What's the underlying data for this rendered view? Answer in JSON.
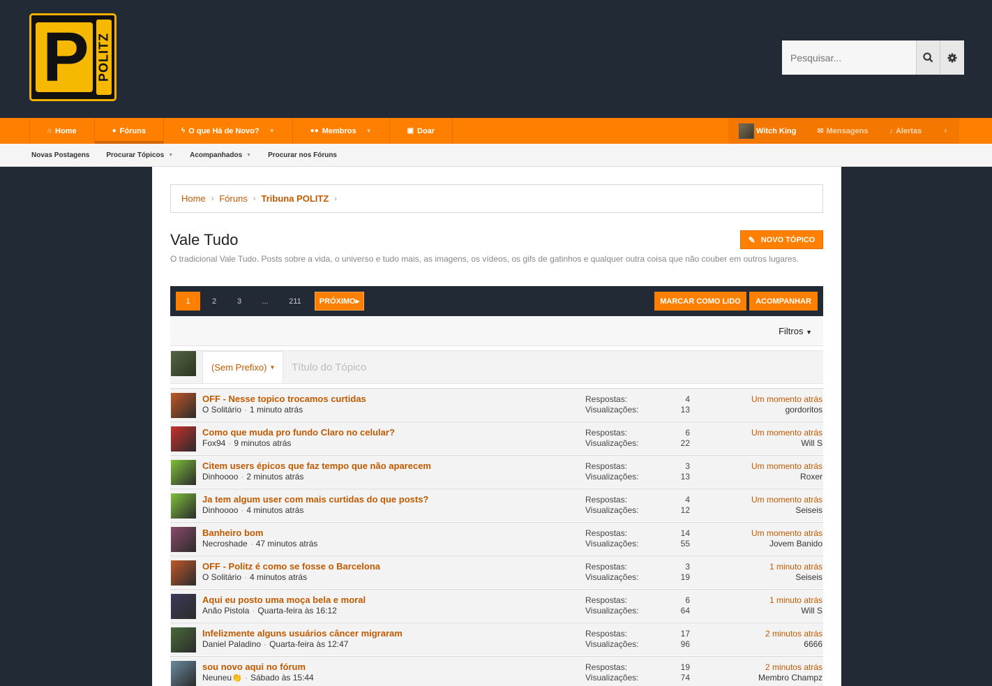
{
  "header": {
    "logo_text": "POLITZ",
    "logo_letter": "P",
    "search_placeholder": "Pesquisar..."
  },
  "nav": {
    "tabs": [
      {
        "label": "Home",
        "icon": "home-icon"
      },
      {
        "label": "Fóruns",
        "icon": "comments-icon",
        "active": true
      },
      {
        "label": "O que Há de Novo?",
        "icon": "bolt-icon",
        "dropdown": true
      },
      {
        "label": "Membros",
        "icon": "users-icon",
        "dropdown": true
      },
      {
        "label": "Doar",
        "icon": "money-icon"
      }
    ],
    "user": "Witch King",
    "messages": "Mensagens",
    "alerts": "Alertas"
  },
  "subnav": {
    "links": [
      "Novas Postagens",
      "Procurar Tópicos",
      "Acompanhados",
      "Procurar nos Fóruns"
    ]
  },
  "breadcrumb": [
    "Home",
    "Fóruns",
    "Tribuna POLITZ"
  ],
  "forum": {
    "title": "Vale Tudo",
    "description": "O tradicional Vale Tudo. Posts sobre a vida, o universo e tudo mais, as imagens, os vídeos, os gifs de gatinhos e qualquer outra coisa que não couber em outros lugares.",
    "new_topic": "NOVO TÓPICO"
  },
  "pagination": {
    "pages": [
      "1",
      "2",
      "3",
      "...",
      "211"
    ],
    "next": "PRÓXIMO",
    "mark_read": "MARCAR COMO LIDO",
    "watch": "ACOMPANHAR"
  },
  "filters_label": "Filtros",
  "quick_thread": {
    "prefix": "(Sem Prefixo)",
    "title_placeholder": "Título do Tópico"
  },
  "labels": {
    "replies": "Respostas:",
    "views": "Visualizações:"
  },
  "threads": [
    {
      "title": "OFF - Nesse topico trocamos curtidas",
      "author": "O Solitário",
      "time": "1 minuto atrás",
      "replies": "4",
      "views": "13",
      "last_time": "Um momento atrás",
      "last_user": "gordoritos",
      "avatar_color": "#c0582a"
    },
    {
      "title": "Como que muda pro fundo Claro no celular?",
      "author": "Fox94",
      "time": "9 minutos atrás",
      "replies": "6",
      "views": "22",
      "last_time": "Um momento atrás",
      "last_user": "Will S",
      "avatar_color": "#c9302c"
    },
    {
      "title": "Citem users épicos que faz tempo que não aparecem",
      "author": "Dinhoooo",
      "time": "2 minutos atrás",
      "replies": "3",
      "views": "13",
      "last_time": "Um momento atrás",
      "last_user": "Roxer",
      "avatar_color": "#7fbf3a"
    },
    {
      "title": "Ja tem algum user com mais curtidas do que posts?",
      "author": "Dinhoooo",
      "time": "4 minutos atrás",
      "replies": "4",
      "views": "12",
      "last_time": "Um momento atrás",
      "last_user": "Seiseis",
      "avatar_color": "#7fbf3a"
    },
    {
      "title": "Banheiro bom",
      "author": "Necroshade",
      "time": "47 minutos atrás",
      "replies": "14",
      "views": "55",
      "last_time": "Um momento atrás",
      "last_user": "Jovem Banido",
      "avatar_color": "#8a4a6a"
    },
    {
      "title": "OFF - Politz é como se fosse o Barcelona",
      "author": "O Solitário",
      "time": "4 minutos atrás",
      "replies": "3",
      "views": "19",
      "last_time": "1 minuto atrás",
      "last_user": "Seiseis",
      "avatar_color": "#c0582a"
    },
    {
      "title": "Aqui eu posto uma moça bela e moral",
      "author": "Anão Pistola",
      "time": "Quarta-feira às 16:12",
      "replies": "6",
      "views": "64",
      "last_time": "1 minuto atrás",
      "last_user": "Will S",
      "avatar_color": "#3a3a5a"
    },
    {
      "title": "Infelizmente alguns usuários câncer migraram",
      "author": "Daniel Paladino",
      "time": "Quarta-feira às 12:47",
      "replies": "17",
      "views": "96",
      "last_time": "2 minutos atrás",
      "last_user": "6666",
      "avatar_color": "#4a6a3a"
    },
    {
      "title": "sou novo aqui no fórum",
      "author": "Neuneu👏",
      "time": "Sábado às 15:44",
      "replies": "19",
      "views": "74",
      "last_time": "2 minutos atrás",
      "last_user": "Membro Champz",
      "avatar_color": "#6a8aa0"
    }
  ]
}
